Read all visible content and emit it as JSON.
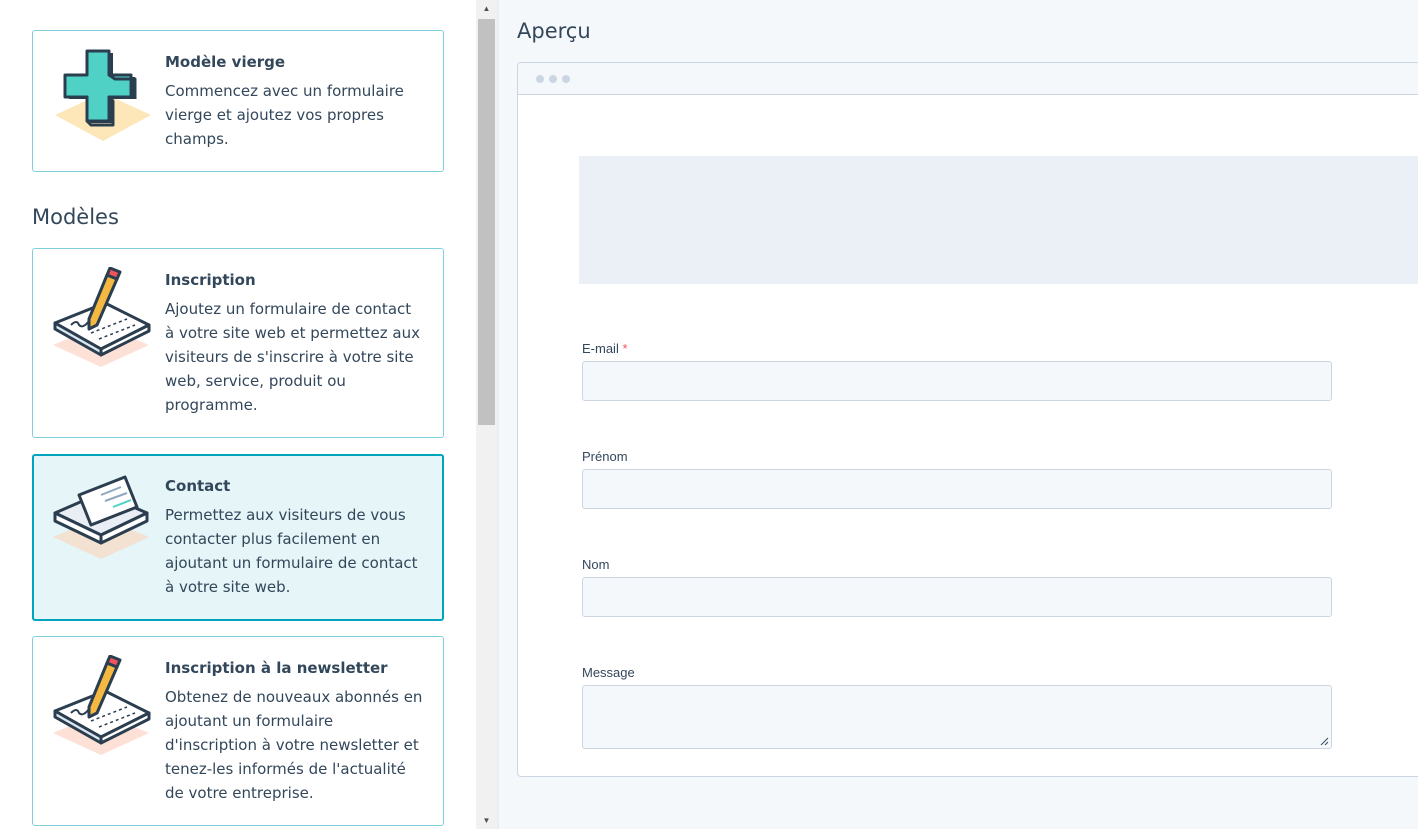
{
  "templates_panel": {
    "blank_card": {
      "title": "Modèle vierge",
      "description": "Commencez avec un formulaire vierge et ajoutez vos propres champs."
    },
    "section_heading": "Modèles",
    "template_cards": [
      {
        "title": "Inscription",
        "description": "Ajoutez un formulaire de contact à votre site web et permettez aux visiteurs de s'inscrire à votre site web, service, produit ou programme.",
        "icon": "signup-pencil-icon"
      },
      {
        "title": "Contact",
        "description": "Permettez aux visiteurs de vous contacter plus facilement en ajoutant un formulaire de contact à votre site web.",
        "icon": "envelope-icon",
        "selected": true
      },
      {
        "title": "Inscription à la newsletter",
        "description": "Obtenez de nouveaux abonnés en ajoutant un formulaire d'inscription à votre newsletter et tenez-les informés de l'actualité de votre entreprise.",
        "icon": "newsletter-pencil-icon"
      }
    ]
  },
  "preview": {
    "title": "Aperçu",
    "fields": [
      {
        "label": "E-mail",
        "required_marker": "*",
        "type": "text"
      },
      {
        "label": "Prénom",
        "type": "text"
      },
      {
        "label": "Nom",
        "type": "text"
      },
      {
        "label": "Message",
        "type": "textarea"
      }
    ]
  },
  "colors": {
    "text": "#33475b",
    "card_border": "#7fd1de",
    "selected_border": "#00a4bd",
    "selected_bg": "#e5f5f8",
    "required": "#f2545b"
  }
}
